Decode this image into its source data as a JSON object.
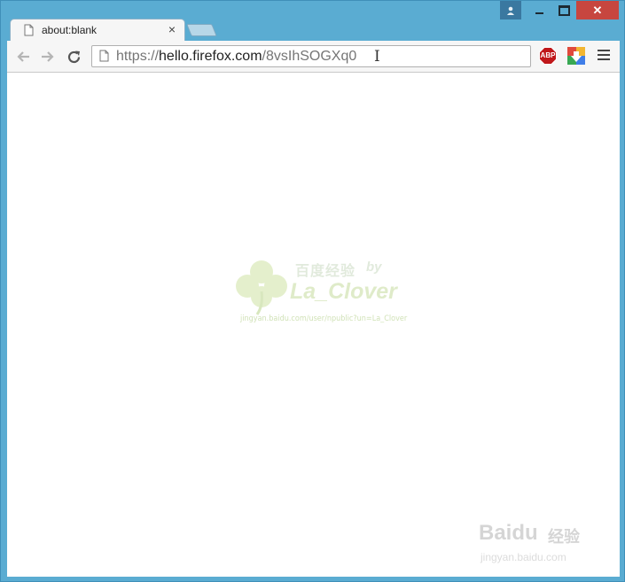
{
  "tab": {
    "title": "about:blank",
    "close_glyph": "×"
  },
  "caption": {
    "profile_icon": "person-icon",
    "close_glyph": "✕"
  },
  "omnibox": {
    "scheme": "https://",
    "host": "hello.firefox.com",
    "path": "/8vsIhSOGXq0",
    "ibeam_glyph": "I"
  },
  "extensions": {
    "adblock_label": "ABP",
    "second_icon": "download-extension-icon"
  },
  "watermarks": {
    "center_title": "百度经验",
    "center_by": "by",
    "center_author": "La_Clover",
    "center_url": "jingyan.baidu.com/user/npublic?un=La_Clover",
    "baidu_logo": "Baidu",
    "baidu_cn": "经验",
    "baidu_url": "jingyan.baidu.com"
  },
  "colors": {
    "frame": "#5aacd2",
    "close": "#c7463f",
    "adblock": "#c0181b"
  }
}
